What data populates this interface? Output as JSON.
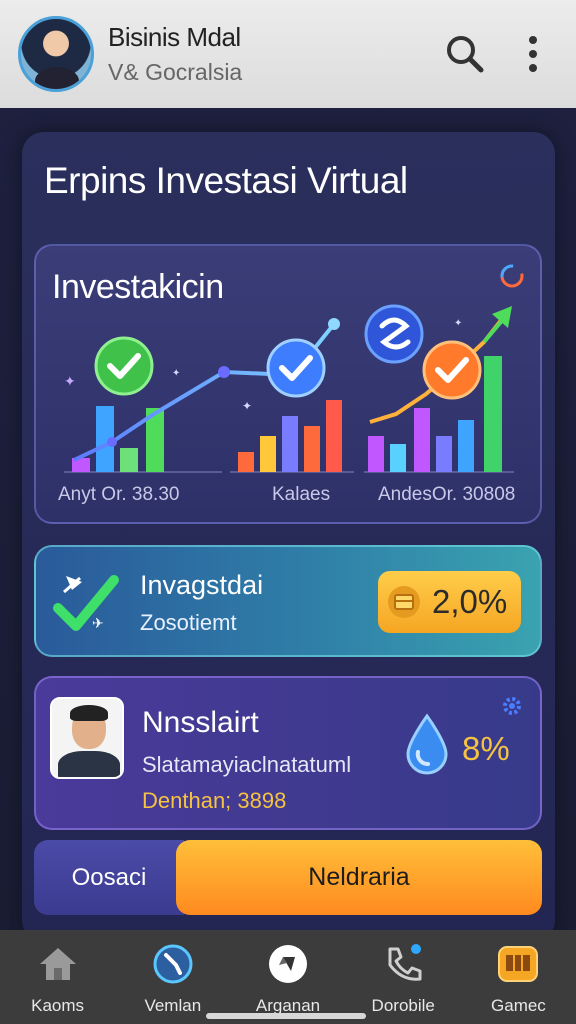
{
  "header": {
    "title": "Bisinis Mdal",
    "subtitle": "V& Gocralsia"
  },
  "panel_title": "Erpins Investasi Virtual",
  "chart_card": {
    "title": "Investakicin",
    "labels": [
      "Anyt Or. 38.30",
      "Kalaes",
      "AndesOr. 30808"
    ]
  },
  "investment": {
    "title": "Invagstdai",
    "subtitle": "Zosotiemt",
    "badge_value": "2,0%"
  },
  "profile": {
    "name": "Nnsslairt",
    "description": "Slatamayiaclnatatuml",
    "meta": "Denthan; 3898",
    "percent": "8%"
  },
  "buttons": {
    "left": "Oosaci",
    "right": "Neldraria"
  },
  "nav": [
    {
      "label": "Kaoms",
      "icon": "home-icon"
    },
    {
      "label": "Vemlan",
      "icon": "compass-icon"
    },
    {
      "label": "Arganan",
      "icon": "diamond-icon"
    },
    {
      "label": "Dorobile",
      "icon": "phone-icon"
    },
    {
      "label": "Gamec",
      "icon": "wallet-icon"
    }
  ],
  "colors": {
    "accent_orange": "#ff8a1f",
    "accent_yellow": "#f5c242",
    "card_blue": "#2f7fa8",
    "card_purple": "#4a3a9a"
  }
}
